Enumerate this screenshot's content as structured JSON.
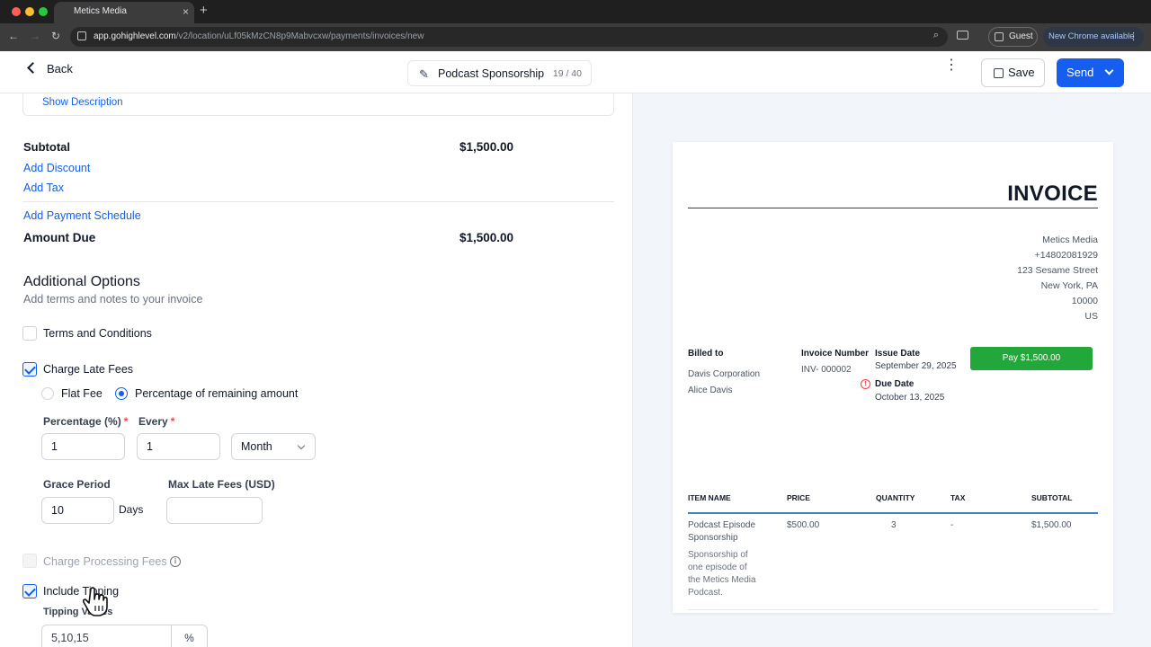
{
  "browser": {
    "tab_title": "Metics Media",
    "tab_close": "×",
    "new_tab": "+",
    "url_host": "app.gohighlevel.com",
    "url_path": "/v2/location/uLf05kMzCN8p9Mabvcxw/payments/invoices/new",
    "guest_label": "Guest",
    "new_chrome_label": "New Chrome available",
    "back_glyph": "←",
    "forward_glyph": "→",
    "reload_glyph": "↻",
    "zoom_glyph": "⌕",
    "menu_glyph": "⋮"
  },
  "header": {
    "back_label": "Back",
    "title": "Podcast Sponsorship",
    "title_count": "19 / 40",
    "pencil_glyph": "✎",
    "kebab_glyph": "⋮",
    "save_label": "Save",
    "send_label": "Send"
  },
  "form": {
    "show_description": "Show Description",
    "subtotal_label": "Subtotal",
    "subtotal_value": "$1,500.00",
    "add_discount": "Add Discount",
    "add_tax": "Add Tax",
    "add_payment_schedule": "Add Payment Schedule",
    "amount_due_label": "Amount Due",
    "amount_due_value": "$1,500.00",
    "additional_title": "Additional Options",
    "additional_sub": "Add terms and notes to your invoice",
    "terms_label": "Terms and Conditions",
    "late_fees_label": "Charge Late Fees",
    "flat_fee_label": "Flat Fee",
    "percentage_label": "Percentage of remaining amount",
    "percentage_field_label": "Percentage (%)",
    "every_field_label": "Every",
    "required_mark": "*",
    "percentage_value": "1",
    "every_value": "1",
    "period_value": "Month",
    "grace_label": "Grace Period",
    "grace_value": "10",
    "days_label": "Days",
    "max_late_label": "Max Late Fees (USD)",
    "max_late_value": "",
    "processing_label": "Charge Processing Fees",
    "info_glyph": "i",
    "tipping_label": "Include Tipping",
    "tipping_values_label": "Tipping Values",
    "tipping_values": "5,10,15",
    "tipping_suffix": "%"
  },
  "invoice": {
    "title": "INVOICE",
    "company": [
      "Metics Media",
      "+14802081929",
      "123 Sesame Street",
      "New York, PA",
      "10000",
      "US"
    ],
    "billed_to_label": "Billed to",
    "billed_to": [
      "Davis Corporation",
      "Alice Davis"
    ],
    "invoice_number_label": "Invoice Number",
    "invoice_number": "INV- 000002",
    "issue_date_label": "Issue Date",
    "issue_date": "September 29, 2025",
    "due_date_label": "Due Date",
    "due_date": "October 13, 2025",
    "pay_button": "Pay $1,500.00",
    "warn_glyph": "!",
    "columns": [
      "ITEM NAME",
      "PRICE",
      "QUANTITY",
      "TAX",
      "SUBTOTAL"
    ],
    "item": {
      "name": "Podcast Episode Sponsorship",
      "price": "$500.00",
      "quantity": "3",
      "tax": "-",
      "subtotal": "$1,500.00",
      "description": "Sponsorship of one episode of the Metics Media Podcast."
    }
  },
  "colors": {
    "primary": "#155eef",
    "pay_green": "#22a83a",
    "preview_bg": "#f2f6fb"
  }
}
